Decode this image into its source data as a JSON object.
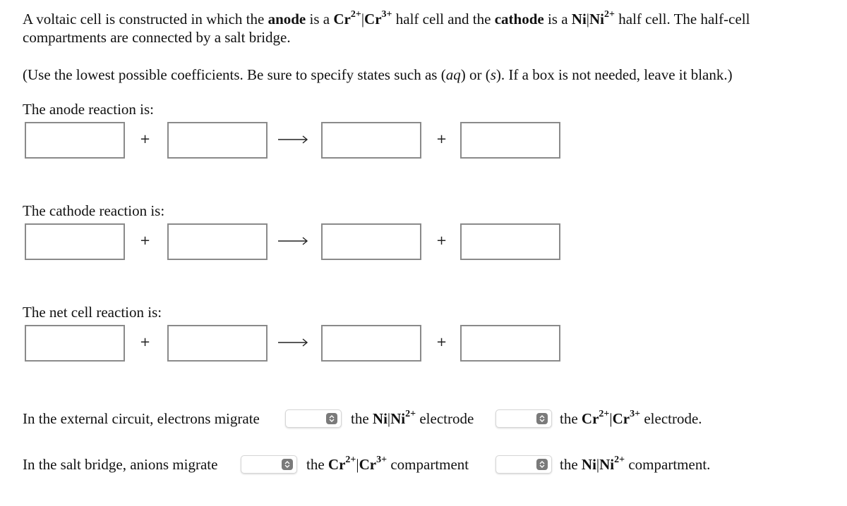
{
  "intro": {
    "p1": "A voltaic cell is constructed in which the ",
    "anode_word": "anode",
    "p2": " is a ",
    "anode_couple_a": "Cr",
    "anode_couple_a_charge": "2+",
    "anode_couple_sep": "|",
    "anode_couple_b": "Cr",
    "anode_couple_b_charge": "3+",
    "p3": " half cell and the ",
    "cathode_word": "cathode",
    "p4": " is a ",
    "cathode_couple_a": "Ni",
    "cathode_couple_sep": "|",
    "cathode_couple_b": "Ni",
    "cathode_couple_b_charge": "2+",
    "p5": " half cell. The half-cell compartments are connected by a salt bridge."
  },
  "instructions": {
    "p1": "(Use the lowest possible coefficients. Be sure to specify states such as (",
    "aq": "aq",
    "p2": ") or (",
    "s": "s",
    "p3": "). If a box is not needed, leave it blank.)"
  },
  "reactions": [
    {
      "label": "The anode reaction is:",
      "boxes": [
        "",
        "",
        "",
        ""
      ],
      "plus": "+",
      "arrow": "arrow-right-icon"
    },
    {
      "label": "The cathode reaction is:",
      "boxes": [
        "",
        "",
        "",
        ""
      ],
      "plus": "+",
      "arrow": "arrow-right-icon"
    },
    {
      "label": "The net cell reaction is:",
      "boxes": [
        "",
        "",
        "",
        ""
      ],
      "plus": "+",
      "arrow": "arrow-right-icon"
    }
  ],
  "external_circuit": {
    "prefix": "In the external circuit, electrons migrate",
    "select1_value": "",
    "middle_the": "the ",
    "middle_a": "Ni",
    "middle_sep": "|",
    "middle_b": "Ni",
    "middle_b_charge": "2+",
    "middle_suffix": " electrode",
    "select2_value": "",
    "end_the": "the ",
    "end_a": "Cr",
    "end_a_charge": "2+",
    "end_sep": "|",
    "end_b": "Cr",
    "end_b_charge": "3+",
    "end_suffix": " electrode."
  },
  "salt_bridge": {
    "prefix": "In the salt bridge, anions migrate",
    "select1_value": "",
    "middle_the": "the ",
    "middle_a": "Cr",
    "middle_a_charge": "2+",
    "middle_sep": "|",
    "middle_b": "Cr",
    "middle_b_charge": "3+",
    "middle_suffix": " compartment",
    "select2_value": "",
    "end_the": "the ",
    "end_a": "Ni",
    "end_sep": "|",
    "end_b": "Ni",
    "end_b_charge": "2+",
    "end_suffix": " compartment."
  }
}
